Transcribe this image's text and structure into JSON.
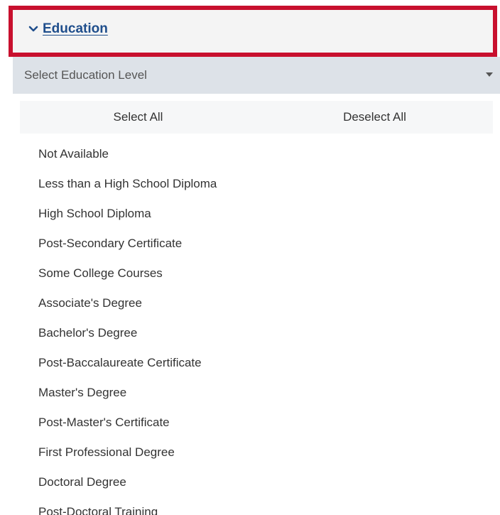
{
  "section": {
    "title": "Education",
    "highlight_color": "#c8102e",
    "title_color": "#1f4e8c",
    "toggle_icon": "chevron-down-icon"
  },
  "select": {
    "placeholder": "Select Education Level",
    "caret_icon": "caret-down-icon"
  },
  "bulk_actions": {
    "select_all": "Select All",
    "deselect_all": "Deselect All"
  },
  "options": [
    "Not Available",
    "Less than a High School Diploma",
    "High School Diploma",
    "Post-Secondary Certificate",
    "Some College Courses",
    "Associate's Degree",
    "Bachelor's Degree",
    "Post-Baccalaureate Certificate",
    "Master's Degree",
    "Post-Master's Certificate",
    "First Professional Degree",
    "Doctoral Degree",
    "Post-Doctoral Training"
  ]
}
